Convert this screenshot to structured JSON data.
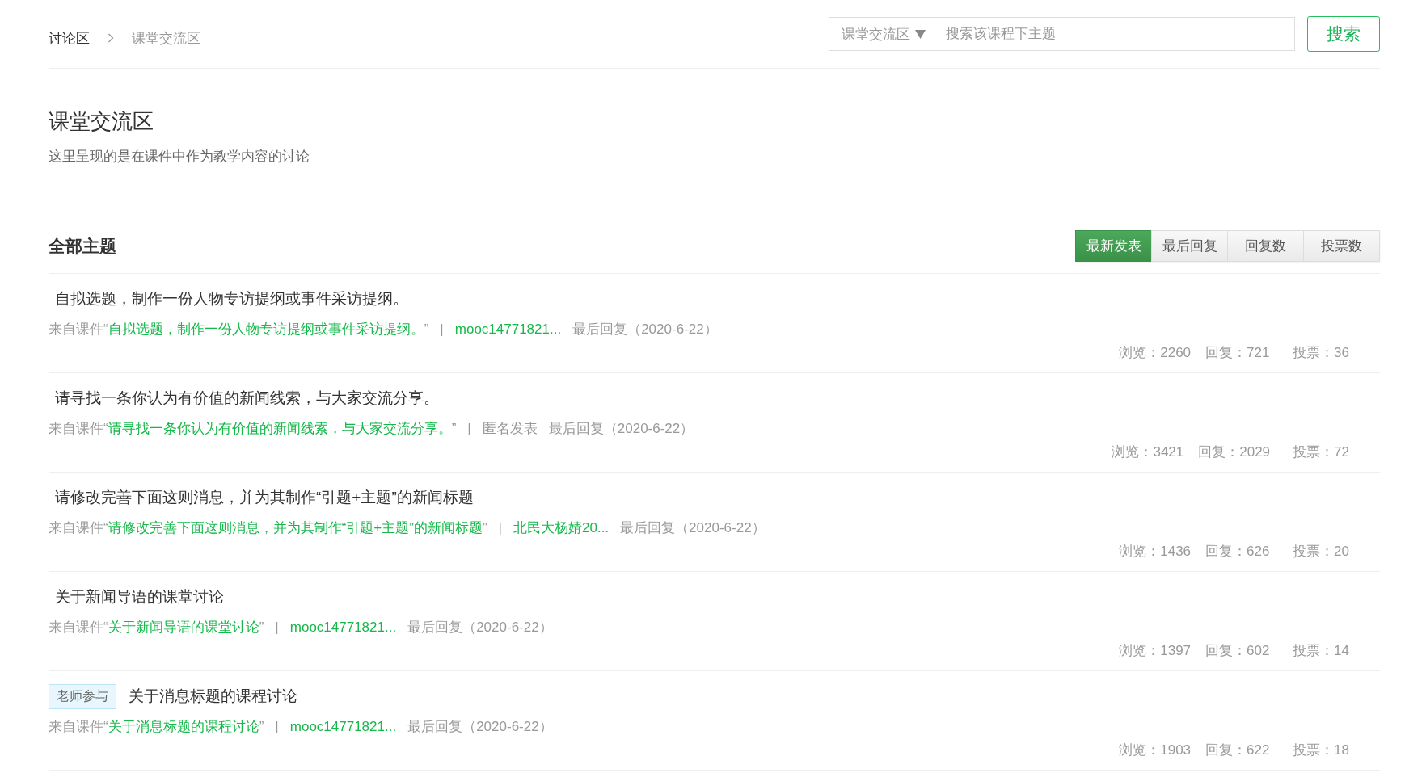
{
  "breadcrumb": [
    {
      "label": "讨论区",
      "current": false
    },
    {
      "label": "课堂交流区",
      "current": true
    }
  ],
  "search": {
    "scope": "课堂交流区",
    "placeholder": "搜索该课程下主题",
    "button": "搜索"
  },
  "section": {
    "title": "课堂交流区",
    "description": "这里呈现的是在课件中作为教学内容的讨论"
  },
  "list": {
    "title": "全部主题",
    "sort_tabs": [
      {
        "label": "最新发表",
        "selected": true
      },
      {
        "label": "最后回复",
        "selected": false
      },
      {
        "label": "回复数",
        "selected": false
      },
      {
        "label": "投票数",
        "selected": false
      }
    ],
    "topics": [
      {
        "title": "自拟选题，制作一份人物专访提纲或事件采访提纲。",
        "source_prefix": "来自课件“",
        "source": "自拟选题，制作一份人物专访提纲或事件采访提纲。",
        "source_suffix": "”",
        "separator": "|",
        "author": {
          "text": "mooc14771821...",
          "kind": "link"
        },
        "last_reply": "最后回复（2020-6-22）",
        "stats": [
          "浏览：2260",
          "回复：721",
          "投票：36"
        ]
      },
      {
        "title": "请寻找一条你认为有价值的新闻线索，与大家交流分享。",
        "source_prefix": "来自课件“",
        "source": "请寻找一条你认为有价值的新闻线索，与大家交流分享。",
        "source_suffix": "”",
        "separator": "|",
        "author": {
          "text": "匿名发表",
          "kind": "anonymous"
        },
        "last_reply": "最后回复（2020-6-22）",
        "stats": [
          "浏览：3421",
          "回复：2029",
          "投票：72"
        ]
      },
      {
        "title": "请修改完善下面这则消息，并为其制作“引题+主题”的新闻标题",
        "source_prefix": "来自课件“",
        "source": "请修改完善下面这则消息，并为其制作“引题+主题”的新闻标题",
        "source_suffix": "”",
        "separator": "|",
        "author": {
          "text": "北民大杨婧20...",
          "kind": "link"
        },
        "last_reply": "最后回复（2020-6-22）",
        "stats": [
          "浏览：1436",
          "回复：626",
          "投票：20"
        ]
      },
      {
        "title": "关于新闻导语的课堂讨论",
        "source_prefix": "来自课件“",
        "source": "关于新闻导语的课堂讨论",
        "source_suffix": "”",
        "separator": "|",
        "author": {
          "text": "mooc14771821...",
          "kind": "link"
        },
        "last_reply": "最后回复（2020-6-22）",
        "stats": [
          "浏览：1397",
          "回复：602",
          "投票：14"
        ]
      },
      {
        "badge": "老师参与",
        "title": "关于消息标题的课程讨论",
        "source_prefix": "来自课件“",
        "source": "关于消息标题的课程讨论",
        "source_suffix": "”",
        "separator": "|",
        "author": {
          "text": "mooc14771821...",
          "kind": "link"
        },
        "last_reply": "最后回复（2020-6-22）",
        "stats": [
          "浏览：1903",
          "回复：622",
          "投票：18"
        ]
      }
    ]
  }
}
